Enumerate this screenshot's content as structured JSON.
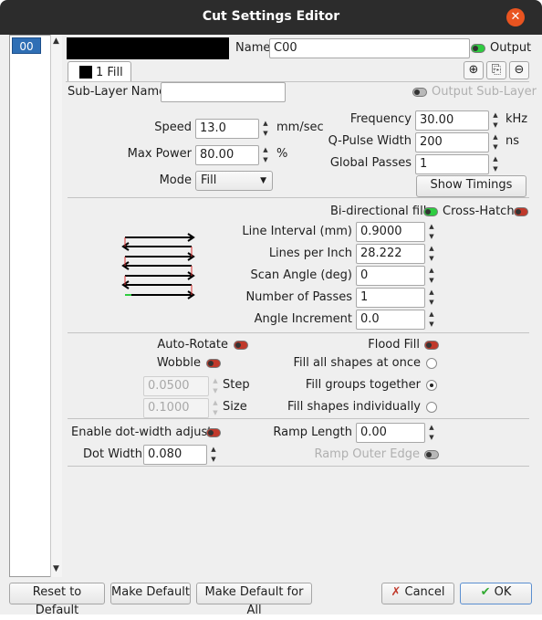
{
  "window": {
    "title": "Cut Settings Editor"
  },
  "layers": [
    {
      "label": "00"
    }
  ],
  "header": {
    "name_label": "Name",
    "name_value": "C00",
    "output_label": "Output",
    "output_on": true,
    "tab_label": "1 Fill",
    "sublayer_label": "Sub-Layer Name",
    "sublayer_value": "",
    "output_sublayer_label": "Output Sub-Layer"
  },
  "basic": {
    "speed_label": "Speed",
    "speed_value": "13.0",
    "speed_unit": "mm/sec",
    "maxpower_label": "Max Power",
    "maxpower_value": "80.00",
    "maxpower_unit": "%",
    "mode_label": "Mode",
    "mode_value": "Fill",
    "frequency_label": "Frequency",
    "frequency_value": "30.00",
    "frequency_unit": "kHz",
    "qpulse_label": "Q-Pulse Width",
    "qpulse_value": "200",
    "qpulse_unit": "ns",
    "globalpasses_label": "Global Passes",
    "globalpasses_value": "1",
    "show_timings_label": "Show Timings"
  },
  "fill": {
    "bidir_label": "Bi-directional fill",
    "bidir_on": true,
    "crosshatch_label": "Cross-Hatch",
    "crosshatch_on": false,
    "line_interval_label": "Line Interval (mm)",
    "line_interval_value": "0.9000",
    "lpi_label": "Lines per Inch",
    "lpi_value": "28.222",
    "scan_angle_label": "Scan Angle (deg)",
    "scan_angle_value": "0",
    "passes_label": "Number of Passes",
    "passes_value": "1",
    "angle_inc_label": "Angle Increment",
    "angle_inc_value": "0.0"
  },
  "options": {
    "autorotate_label": "Auto-Rotate",
    "wobble_label": "Wobble",
    "step_value": "0.0500",
    "step_label": "Step",
    "size_value": "0.1000",
    "size_label": "Size",
    "floodfill_label": "Flood Fill",
    "fill_all_label": "Fill all shapes at once",
    "fill_groups_label": "Fill groups together",
    "fill_individually_label": "Fill shapes individually",
    "selected_fill_order": "Fill groups together"
  },
  "dot": {
    "enable_label": "Enable dot-width adjust",
    "dotwidth_label": "Dot Width:",
    "dotwidth_value": "0.080",
    "ramp_length_label": "Ramp Length",
    "ramp_length_value": "0.00",
    "ramp_outer_label": "Ramp Outer Edge"
  },
  "footer": {
    "reset_label": "Reset to Default",
    "make_default_label": "Make Default",
    "make_default_all_label": "Make Default for All",
    "cancel_label": "Cancel",
    "ok_label": "OK"
  },
  "colors": {
    "accent": "#e95420",
    "toggle_on": "#2ecc40",
    "toggle_off": "#c0392b",
    "selection": "#2f6fb5"
  }
}
